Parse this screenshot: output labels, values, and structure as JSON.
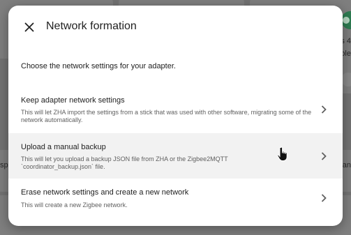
{
  "background": {
    "fragments": {
      "right_top": "s 4",
      "right_mid": "ole",
      "left_partial": "sp",
      "right_partial": "an"
    }
  },
  "dialog": {
    "title": "Network formation",
    "intro": "Choose the network settings for your adapter.",
    "options": [
      {
        "title": "Keep adapter network settings",
        "description": "This will let ZHA import the settings from a stick that was used with other software, migrating some of the network automatically."
      },
      {
        "title": "Upload a manual backup",
        "description": "This will let you upload a backup JSON file from ZHA or the Zigbee2MQTT `coordinator_backup.json` file."
      },
      {
        "title": "Erase network settings and create a new network",
        "description": "This will create a new Zigbee network."
      }
    ]
  },
  "icons": {
    "close": "close-icon",
    "chevron": "chevron-right-icon",
    "cursor": "hand-pointer-cursor"
  }
}
